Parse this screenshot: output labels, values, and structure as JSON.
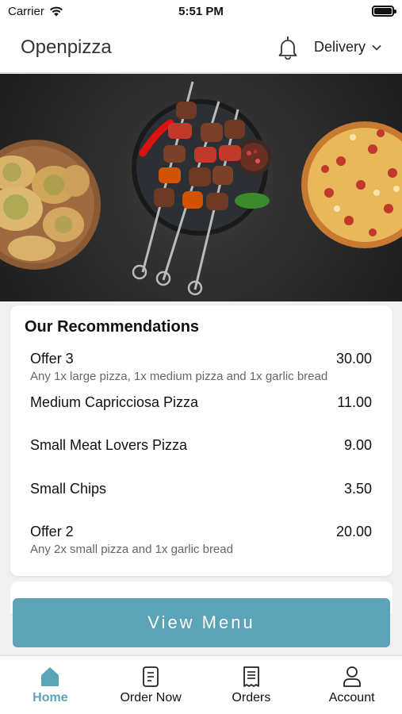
{
  "status_bar": {
    "carrier": "Carrier",
    "time": "5:51 PM"
  },
  "header": {
    "title": "Openpizza",
    "delivery_label": "Delivery"
  },
  "hero": {
    "icon": "food-photo"
  },
  "recommendations": {
    "title": "Our Recommendations",
    "items": [
      {
        "name": "Offer 3",
        "price": "30.00",
        "description": "Any 1x large pizza, 1x medium pizza and 1x garlic bread"
      },
      {
        "name": "Medium Capricciosa Pizza",
        "price": "11.00",
        "description": ""
      },
      {
        "name": "Small Meat Lovers Pizza",
        "price": "9.00",
        "description": ""
      },
      {
        "name": "Small Chips",
        "price": "3.50",
        "description": ""
      },
      {
        "name": "Offer 2",
        "price": "20.00",
        "description": "Any 2x small pizza and 1x garlic bread"
      }
    ]
  },
  "view_menu_label": "View Menu",
  "tabs": [
    {
      "label": "Home",
      "icon": "home-icon",
      "active": true
    },
    {
      "label": "Order Now",
      "icon": "order-icon",
      "active": false
    },
    {
      "label": "Orders",
      "icon": "receipt-icon",
      "active": false
    },
    {
      "label": "Account",
      "icon": "user-icon",
      "active": false
    }
  ],
  "colors": {
    "accent": "#5ba3b7",
    "hero_bg": "#2a2a2a"
  }
}
